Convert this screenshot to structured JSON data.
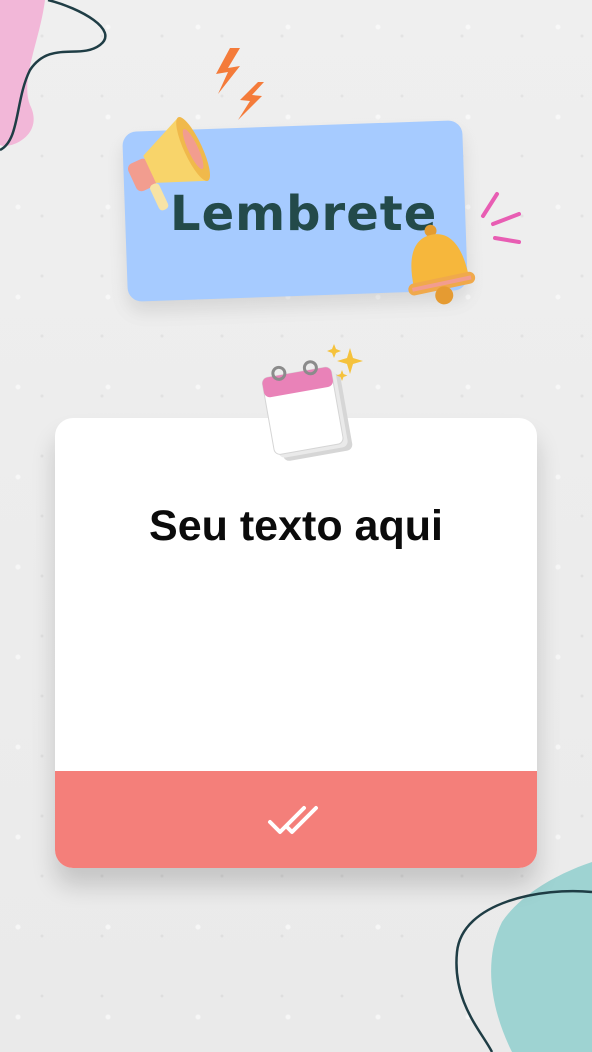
{
  "header": {
    "title": "Lembrete"
  },
  "card": {
    "text": "Seu texto aqui"
  },
  "colors": {
    "badge": "#a6cbff",
    "footer": "#f47f7a",
    "blob_pink": "#f2b7d8",
    "blob_teal": "#9ed3d2"
  }
}
